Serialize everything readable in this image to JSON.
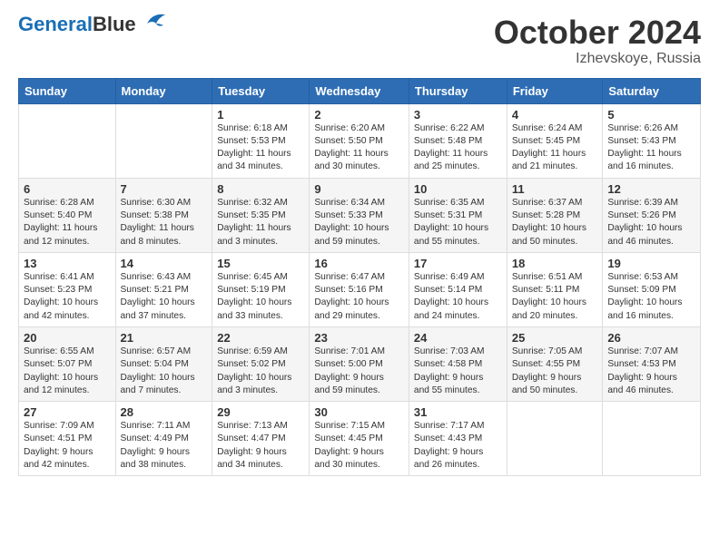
{
  "header": {
    "logo_line1": "General",
    "logo_line2": "Blue",
    "title": "October 2024",
    "location": "Izhevskoye, Russia"
  },
  "weekdays": [
    "Sunday",
    "Monday",
    "Tuesday",
    "Wednesday",
    "Thursday",
    "Friday",
    "Saturday"
  ],
  "weeks": [
    [
      {
        "day": "",
        "info": ""
      },
      {
        "day": "",
        "info": ""
      },
      {
        "day": "1",
        "info": "Sunrise: 6:18 AM\nSunset: 5:53 PM\nDaylight: 11 hours\nand 34 minutes."
      },
      {
        "day": "2",
        "info": "Sunrise: 6:20 AM\nSunset: 5:50 PM\nDaylight: 11 hours\nand 30 minutes."
      },
      {
        "day": "3",
        "info": "Sunrise: 6:22 AM\nSunset: 5:48 PM\nDaylight: 11 hours\nand 25 minutes."
      },
      {
        "day": "4",
        "info": "Sunrise: 6:24 AM\nSunset: 5:45 PM\nDaylight: 11 hours\nand 21 minutes."
      },
      {
        "day": "5",
        "info": "Sunrise: 6:26 AM\nSunset: 5:43 PM\nDaylight: 11 hours\nand 16 minutes."
      }
    ],
    [
      {
        "day": "6",
        "info": "Sunrise: 6:28 AM\nSunset: 5:40 PM\nDaylight: 11 hours\nand 12 minutes."
      },
      {
        "day": "7",
        "info": "Sunrise: 6:30 AM\nSunset: 5:38 PM\nDaylight: 11 hours\nand 8 minutes."
      },
      {
        "day": "8",
        "info": "Sunrise: 6:32 AM\nSunset: 5:35 PM\nDaylight: 11 hours\nand 3 minutes."
      },
      {
        "day": "9",
        "info": "Sunrise: 6:34 AM\nSunset: 5:33 PM\nDaylight: 10 hours\nand 59 minutes."
      },
      {
        "day": "10",
        "info": "Sunrise: 6:35 AM\nSunset: 5:31 PM\nDaylight: 10 hours\nand 55 minutes."
      },
      {
        "day": "11",
        "info": "Sunrise: 6:37 AM\nSunset: 5:28 PM\nDaylight: 10 hours\nand 50 minutes."
      },
      {
        "day": "12",
        "info": "Sunrise: 6:39 AM\nSunset: 5:26 PM\nDaylight: 10 hours\nand 46 minutes."
      }
    ],
    [
      {
        "day": "13",
        "info": "Sunrise: 6:41 AM\nSunset: 5:23 PM\nDaylight: 10 hours\nand 42 minutes."
      },
      {
        "day": "14",
        "info": "Sunrise: 6:43 AM\nSunset: 5:21 PM\nDaylight: 10 hours\nand 37 minutes."
      },
      {
        "day": "15",
        "info": "Sunrise: 6:45 AM\nSunset: 5:19 PM\nDaylight: 10 hours\nand 33 minutes."
      },
      {
        "day": "16",
        "info": "Sunrise: 6:47 AM\nSunset: 5:16 PM\nDaylight: 10 hours\nand 29 minutes."
      },
      {
        "day": "17",
        "info": "Sunrise: 6:49 AM\nSunset: 5:14 PM\nDaylight: 10 hours\nand 24 minutes."
      },
      {
        "day": "18",
        "info": "Sunrise: 6:51 AM\nSunset: 5:11 PM\nDaylight: 10 hours\nand 20 minutes."
      },
      {
        "day": "19",
        "info": "Sunrise: 6:53 AM\nSunset: 5:09 PM\nDaylight: 10 hours\nand 16 minutes."
      }
    ],
    [
      {
        "day": "20",
        "info": "Sunrise: 6:55 AM\nSunset: 5:07 PM\nDaylight: 10 hours\nand 12 minutes."
      },
      {
        "day": "21",
        "info": "Sunrise: 6:57 AM\nSunset: 5:04 PM\nDaylight: 10 hours\nand 7 minutes."
      },
      {
        "day": "22",
        "info": "Sunrise: 6:59 AM\nSunset: 5:02 PM\nDaylight: 10 hours\nand 3 minutes."
      },
      {
        "day": "23",
        "info": "Sunrise: 7:01 AM\nSunset: 5:00 PM\nDaylight: 9 hours\nand 59 minutes."
      },
      {
        "day": "24",
        "info": "Sunrise: 7:03 AM\nSunset: 4:58 PM\nDaylight: 9 hours\nand 55 minutes."
      },
      {
        "day": "25",
        "info": "Sunrise: 7:05 AM\nSunset: 4:55 PM\nDaylight: 9 hours\nand 50 minutes."
      },
      {
        "day": "26",
        "info": "Sunrise: 7:07 AM\nSunset: 4:53 PM\nDaylight: 9 hours\nand 46 minutes."
      }
    ],
    [
      {
        "day": "27",
        "info": "Sunrise: 7:09 AM\nSunset: 4:51 PM\nDaylight: 9 hours\nand 42 minutes."
      },
      {
        "day": "28",
        "info": "Sunrise: 7:11 AM\nSunset: 4:49 PM\nDaylight: 9 hours\nand 38 minutes."
      },
      {
        "day": "29",
        "info": "Sunrise: 7:13 AM\nSunset: 4:47 PM\nDaylight: 9 hours\nand 34 minutes."
      },
      {
        "day": "30",
        "info": "Sunrise: 7:15 AM\nSunset: 4:45 PM\nDaylight: 9 hours\nand 30 minutes."
      },
      {
        "day": "31",
        "info": "Sunrise: 7:17 AM\nSunset: 4:43 PM\nDaylight: 9 hours\nand 26 minutes."
      },
      {
        "day": "",
        "info": ""
      },
      {
        "day": "",
        "info": ""
      }
    ]
  ]
}
